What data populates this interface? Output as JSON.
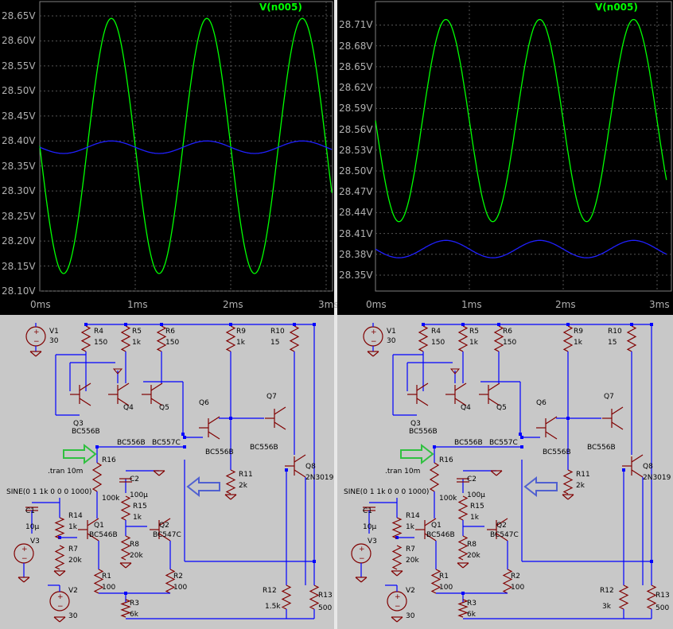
{
  "panels": [
    {
      "trace_title": "V(n005)",
      "y_ticks": [
        "28.65V",
        "28.60V",
        "28.55V",
        "28.50V",
        "28.45V",
        "28.40V",
        "28.35V",
        "28.30V",
        "28.25V",
        "28.20V",
        "28.15V",
        "28.10V"
      ],
      "x_ticks": [
        "0ms",
        "1ms",
        "2ms",
        "3ms"
      ],
      "labels": {
        "v1": "V1",
        "v1v": "30",
        "r4": "R4",
        "r4v": "150",
        "r5": "R5",
        "r5v": "1k",
        "r6": "R6",
        "r6v": "150",
        "r9": "R9",
        "r9v": "1k",
        "r10": "R10",
        "r10v": "15",
        "q3": "Q3",
        "q3v": "BC556B",
        "q4": "Q4",
        "q4v": "BC556B",
        "q5": "Q5",
        "q5v": "BC557C",
        "q6": "Q6",
        "q6v": "BC556B",
        "q7": "Q7",
        "q7v": "BC556B",
        "tran": ".tran 10m",
        "r16": "R16",
        "r16v": "100k",
        "r11": "R11",
        "r11v": "2k",
        "q8": "Q8",
        "q8v": "2N3019",
        "c2": "C2",
        "c2v": "100µ",
        "r15": "R15",
        "r15v": "1k",
        "sine": "SINE(0 1 1k 0 0 0 1000)",
        "c1": "C1",
        "c1v": "10µ",
        "r14": "R14",
        "r14v": "1k",
        "q1": "Q1",
        "q1v": "BC546B",
        "q2": "Q2",
        "q2v": "BC547C",
        "v3": "V3",
        "r7": "R7",
        "r7v": "20k",
        "r8": "R8",
        "r8v": "20k",
        "r1": "R1",
        "r1v": "100",
        "r2": "R2",
        "r2v": "100",
        "v2": "V2",
        "v2v": "30",
        "r3": "R3",
        "r3v": "6k",
        "r12": "R12",
        "r12v": "1.5k",
        "r13": "R13",
        "r13v": "500"
      }
    },
    {
      "trace_title": "V(n005)",
      "y_ticks": [
        "28.71V",
        "28.68V",
        "28.65V",
        "28.62V",
        "28.59V",
        "28.56V",
        "28.53V",
        "28.50V",
        "28.47V",
        "28.44V",
        "28.41V",
        "28.38V",
        "28.35V"
      ],
      "x_ticks": [
        "0ms",
        "1ms",
        "2ms",
        "3ms"
      ],
      "labels": {
        "v1": "V1",
        "v1v": "30",
        "r4": "R4",
        "r4v": "150",
        "r5": "R5",
        "r5v": "1k",
        "r6": "R6",
        "r6v": "150",
        "r9": "R9",
        "r9v": "1k",
        "r10": "R10",
        "r10v": "15",
        "q3": "Q3",
        "q3v": "BC556B",
        "q4": "Q4",
        "q4v": "BC556B",
        "q5": "Q5",
        "q5v": "BC557C",
        "q6": "Q6",
        "q6v": "BC556B",
        "q7": "Q7",
        "q7v": "BC556B",
        "tran": ".tran 10m",
        "r16": "R16",
        "r16v": "100k",
        "r11": "R11",
        "r11v": "2k",
        "q8": "Q8",
        "q8v": "2N3019",
        "c2": "C2",
        "c2v": "100µ",
        "r15": "R15",
        "r15v": "1k",
        "sine": "SINE(0 1 1k 0 0 0 1000)",
        "c1": "C1",
        "c1v": "10µ",
        "r14": "R14",
        "r14v": "1k",
        "q1": "Q1",
        "q1v": "BC546B",
        "q2": "Q2",
        "q2v": "BC547C",
        "v3": "V3",
        "r7": "R7",
        "r7v": "20k",
        "r8": "R8",
        "r8v": "20k",
        "r1": "R1",
        "r1v": "100",
        "r2": "R2",
        "r2v": "100",
        "v2": "V2",
        "v2v": "30",
        "r3": "R3",
        "r3v": "6k",
        "r12": "R12",
        "r12v": "3k",
        "r13": "R13",
        "r13v": "500"
      }
    }
  ],
  "chart_data": [
    {
      "type": "line",
      "x_range_ms": [
        0,
        3.1
      ],
      "ylim": [
        28.1,
        28.65
      ],
      "series": [
        {
          "name": "V(n005)",
          "color": "#00ff00",
          "kind": "sine",
          "mean": 28.39,
          "amplitude": 0.255,
          "freq_khz": 1.0,
          "peak_ms": 0.75
        },
        {
          "color": "#2020ff",
          "kind": "sine",
          "mean": 28.3875,
          "amplitude": 0.0125,
          "freq_khz": 1.0,
          "peak_ms": 0.75
        }
      ]
    },
    {
      "type": "line",
      "x_range_ms": [
        0,
        3.1
      ],
      "ylim": [
        28.35,
        28.73
      ],
      "series": [
        {
          "name": "V(n005)",
          "color": "#00ff00",
          "kind": "sine",
          "mean": 28.5725,
          "amplitude": 0.1455,
          "freq_khz": 1.0,
          "peak_ms": 0.75
        },
        {
          "color": "#2020ff",
          "kind": "sine",
          "mean": 28.3875,
          "amplitude": 0.0125,
          "freq_khz": 1.0,
          "peak_ms": 0.75
        }
      ]
    }
  ],
  "colors": {
    "plot_bg": "#000000",
    "grid": "#606060",
    "wire": "#0000ff",
    "component": "#800000",
    "arrow_green": "#30c040",
    "arrow_blue": "#5060d0",
    "schematic_bg": "#c8c8c8"
  }
}
